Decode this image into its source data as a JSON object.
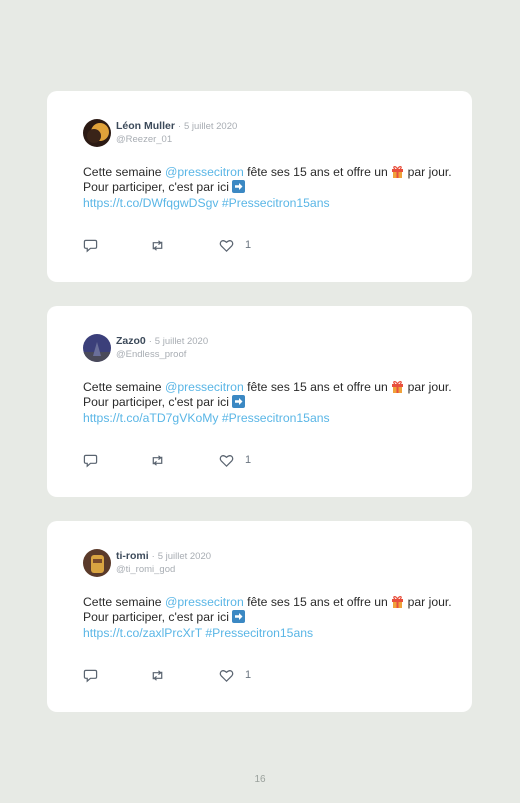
{
  "tweets": [
    {
      "name": "Léon Muller",
      "separator": "·",
      "date": "5 juillet 2020",
      "handle": "@Reezer_01",
      "text_before": "Cette semaine ",
      "mention": "@pressecitron",
      "text_middle": " fête ses 15 ans et offre un ",
      "text_after": " par jour. Pour participer, c'est par ici ",
      "link": "https://t.co/DWfqgwDSgv",
      "hashtag": "#Pressecitron15ans",
      "likes": "1",
      "avatar_colors": [
        "#2b1a14",
        "#e0a23a"
      ]
    },
    {
      "name": "Zazo0",
      "separator": "·",
      "date": "5 juillet 2020",
      "handle": "@Endless_proof",
      "text_before": "Cette semaine ",
      "mention": "@pressecitron",
      "text_middle": " fête ses 15 ans et offre un ",
      "text_after": " par jour. Pour participer, c'est par ici ",
      "link": "https://t.co/aTD7gVKoMy",
      "hashtag": "#Pressecitron15ans",
      "likes": "1",
      "avatar_colors": [
        "#3b3f7a",
        "#6a6f9a"
      ]
    },
    {
      "name": "ti-romi",
      "separator": "·",
      "date": "5 juillet 2020",
      "handle": "@ti_romi_god",
      "text_before": "Cette semaine ",
      "mention": "@pressecitron",
      "text_middle": " fête ses 15 ans et offre un ",
      "text_after": " par jour. Pour participer, c'est par ici ",
      "link": "https://t.co/zaxlPrcXrT",
      "hashtag": "#Pressecitron15ans",
      "likes": "1",
      "avatar_colors": [
        "#5a3a2a",
        "#d9a441"
      ]
    }
  ],
  "icons": {
    "gift": "gift-emoji-icon",
    "arrow": "right-arrow-emoji-icon",
    "reply": "reply-icon",
    "retweet": "retweet-icon",
    "like": "heart-icon"
  },
  "colors": {
    "background": "#e7eae5",
    "card": "#ffffff",
    "link": "#5ab6e6",
    "name": "#3c4a5a",
    "meta": "#a8adb3"
  },
  "page_number": "16"
}
